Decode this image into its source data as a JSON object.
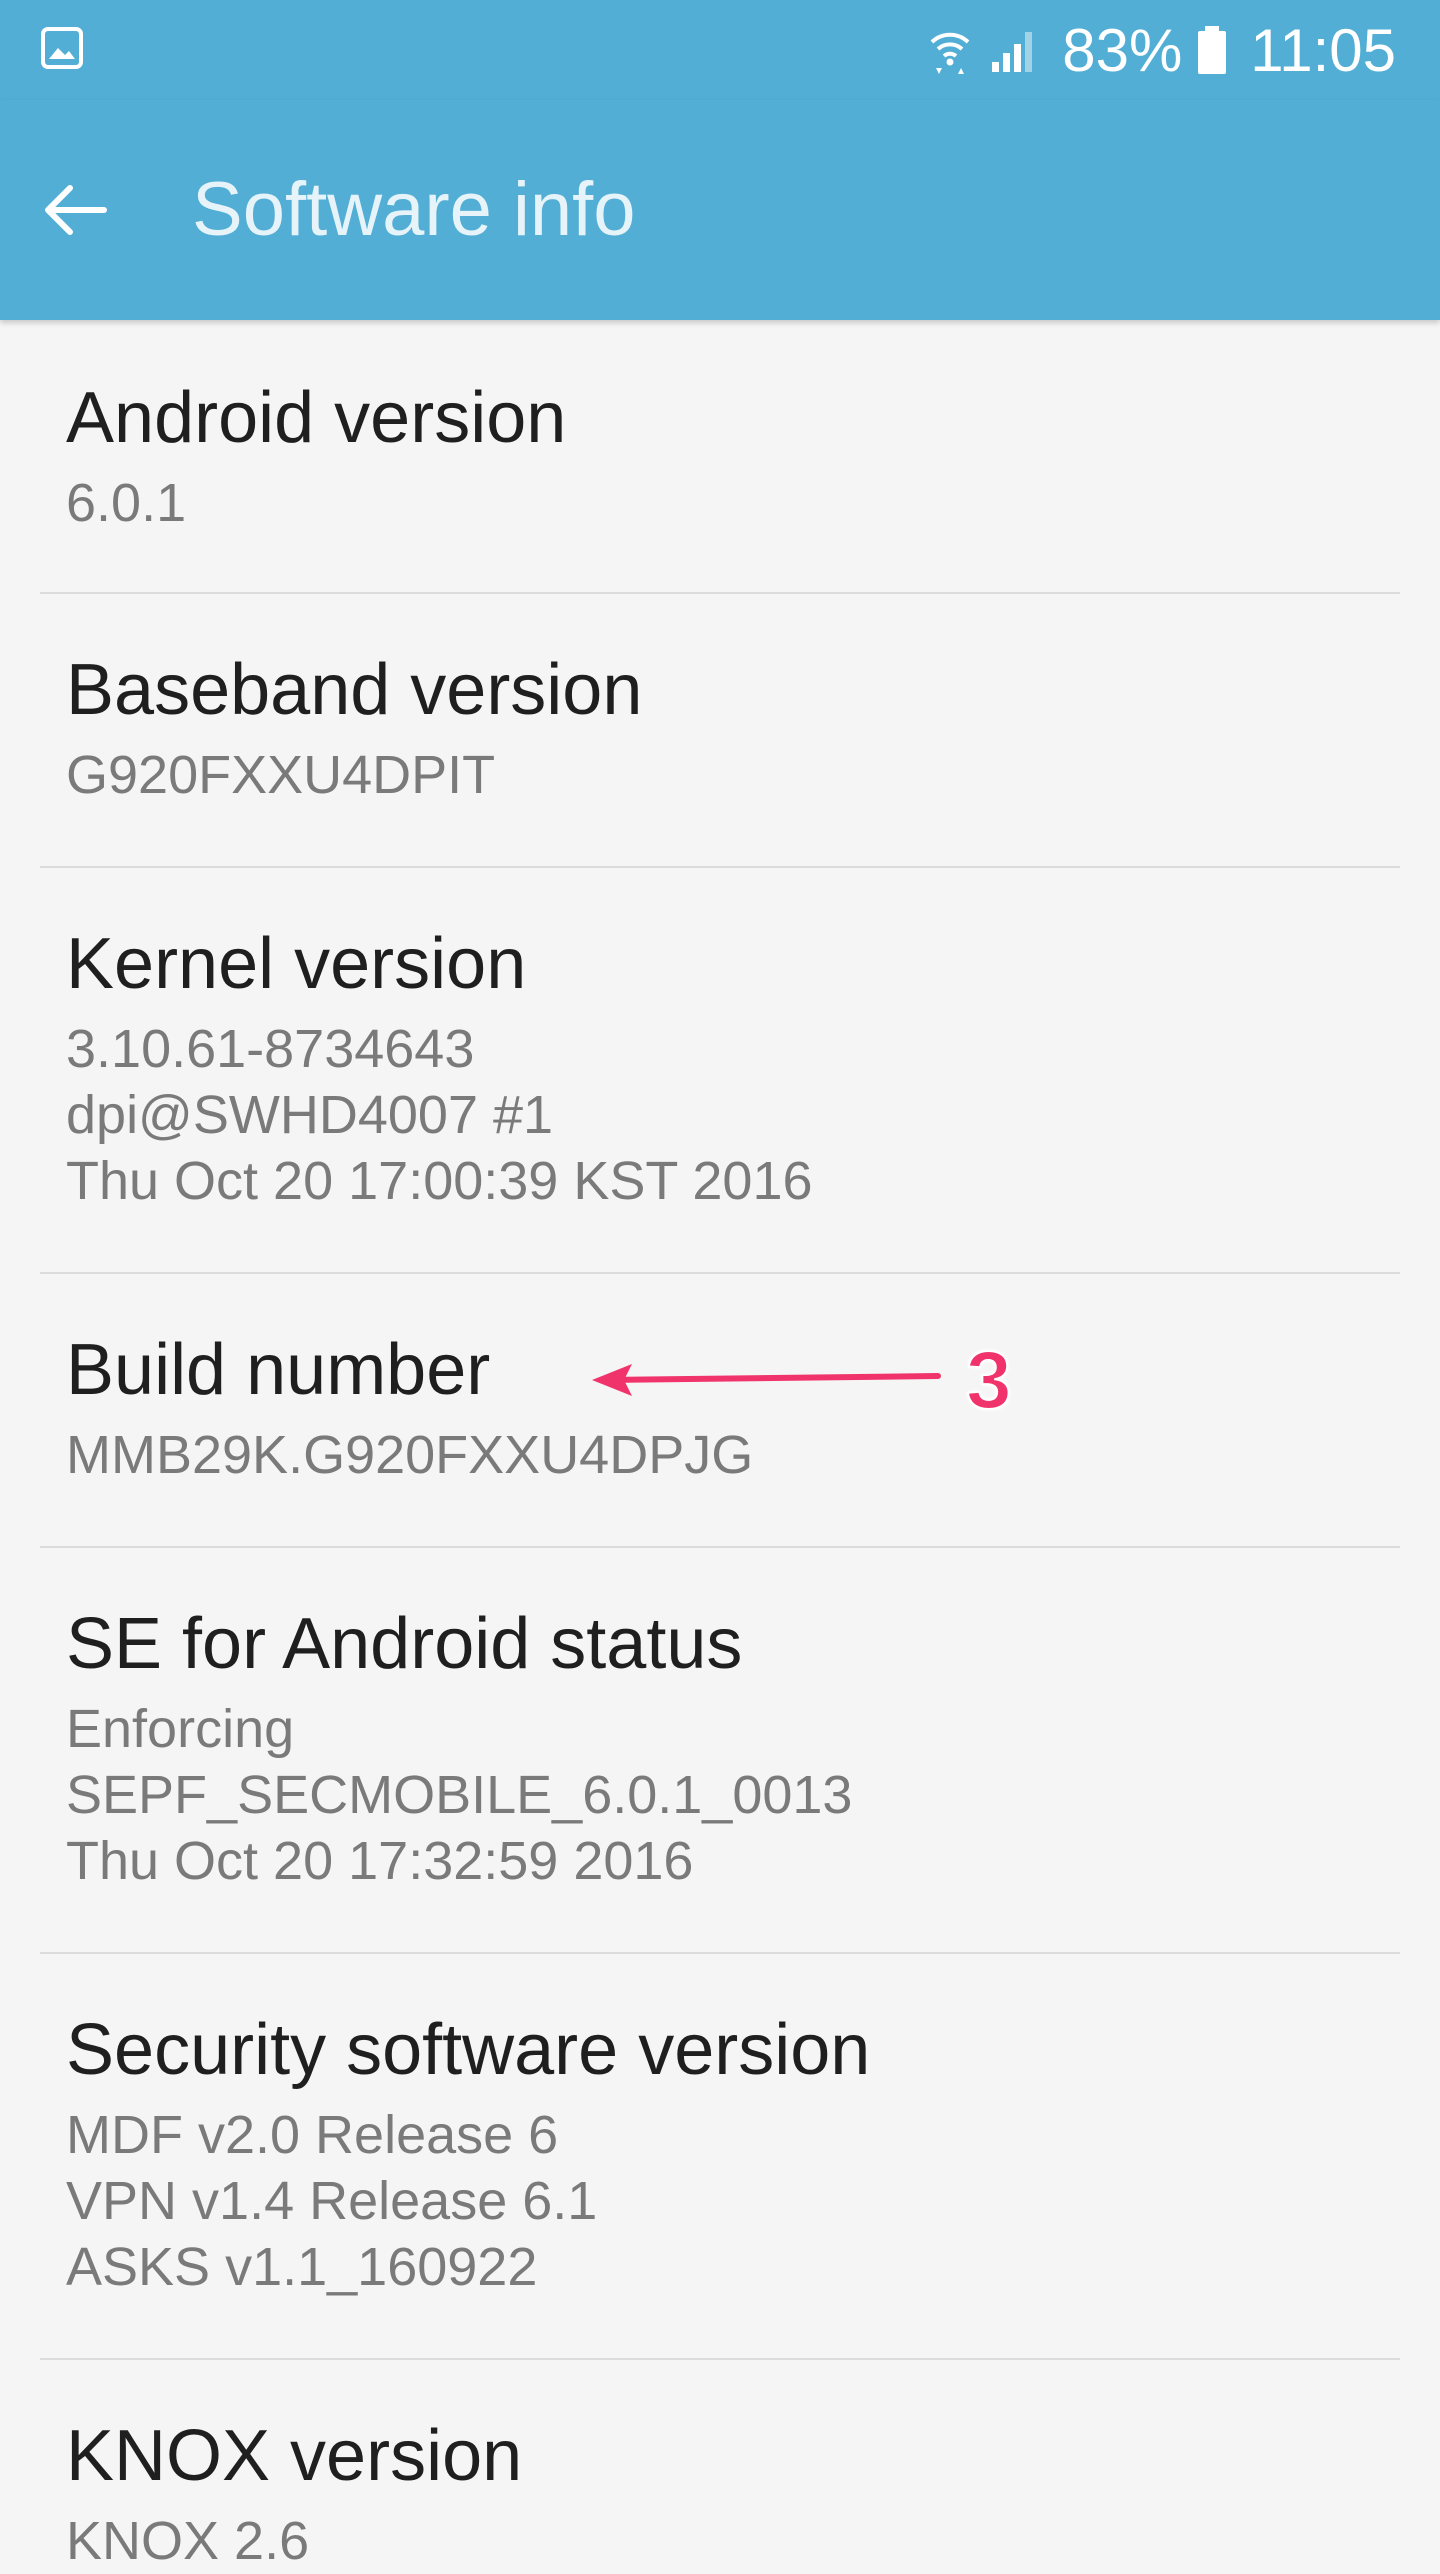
{
  "statusbar": {
    "left_icon": "gallery-notification-icon",
    "wifi_icon": "wifi-icon",
    "signal_icon": "signal-icon",
    "battery_percent": "83%",
    "battery_icon": "battery-icon",
    "time": "11:05"
  },
  "appbar": {
    "back_icon": "arrow-back-icon",
    "title": "Software info",
    "background_color": "#52aed5"
  },
  "items": [
    {
      "title": "Android version",
      "lines": [
        "6.0.1"
      ]
    },
    {
      "title": "Baseband version",
      "lines": [
        "G920FXXU4DPIT"
      ]
    },
    {
      "title": "Kernel version",
      "lines": [
        "3.10.61-8734643",
        "dpi@SWHD4007 #1",
        "Thu Oct 20 17:00:39 KST 2016"
      ]
    },
    {
      "title": "Build number",
      "lines": [
        "MMB29K.G920FXXU4DPJG"
      ]
    },
    {
      "title": "SE for Android status",
      "lines": [
        "Enforcing",
        "SEPF_SECMOBILE_6.0.1_0013",
        "Thu Oct 20 17:32:59 2016"
      ]
    },
    {
      "title": "Security software version",
      "lines": [
        "MDF v2.0 Release 6",
        "VPN v1.4 Release 6.1",
        "ASKS v1.1_160922"
      ]
    },
    {
      "title": "KNOX version",
      "lines": [
        "KNOX 2.6"
      ]
    }
  ],
  "annotation": {
    "number": "3",
    "color": "#f0336b",
    "arrow_icon": "annotation-arrow-icon"
  }
}
